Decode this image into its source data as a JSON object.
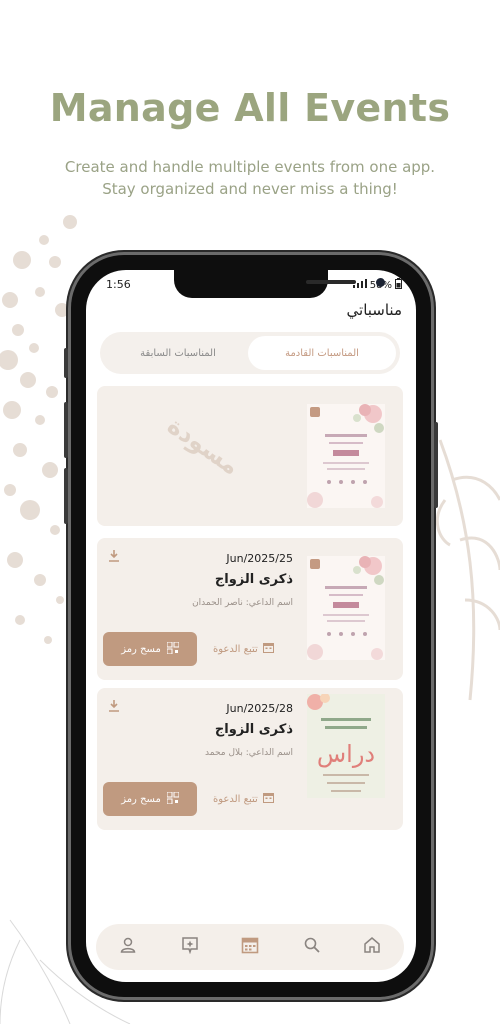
{
  "promo": {
    "title": "Manage All Events",
    "subtitle_line1": "Create and handle multiple events from one app.",
    "subtitle_line2": "Stay organized and never miss a thing!"
  },
  "status_bar": {
    "time": "1:56",
    "battery": "58%"
  },
  "header": {
    "title": "مناسباتي"
  },
  "tabs": [
    {
      "label": "المناسبات القادمة",
      "active": true
    },
    {
      "label": "المناسبات السابقة",
      "active": false
    }
  ],
  "draft_card": {
    "watermark": "مسودة"
  },
  "events": [
    {
      "date": "Jun/2025/25",
      "name": "ذكرى الزواج",
      "host": "اسم الداعي: ناصر الحمدان",
      "scan_label": "مسح رمز",
      "track_label": "تتبع الدعوة",
      "thumb_style": "floral-pink"
    },
    {
      "date": "Jun/2025/28",
      "name": "ذكرى الزواج",
      "host": "اسم الداعي: بلال محمد",
      "scan_label": "مسح رمز",
      "track_label": "تتبع الدعوة",
      "thumb_style": "floral-green"
    }
  ],
  "bottom_nav": [
    {
      "icon": "profile-icon"
    },
    {
      "icon": "sparkle-message-icon"
    },
    {
      "icon": "calendar-icon",
      "active": true
    },
    {
      "icon": "search-icon"
    },
    {
      "icon": "home-icon"
    }
  ],
  "colors": {
    "accent": "#c09a80",
    "title_green": "#9ba57f",
    "card_bg": "#f4efea"
  }
}
